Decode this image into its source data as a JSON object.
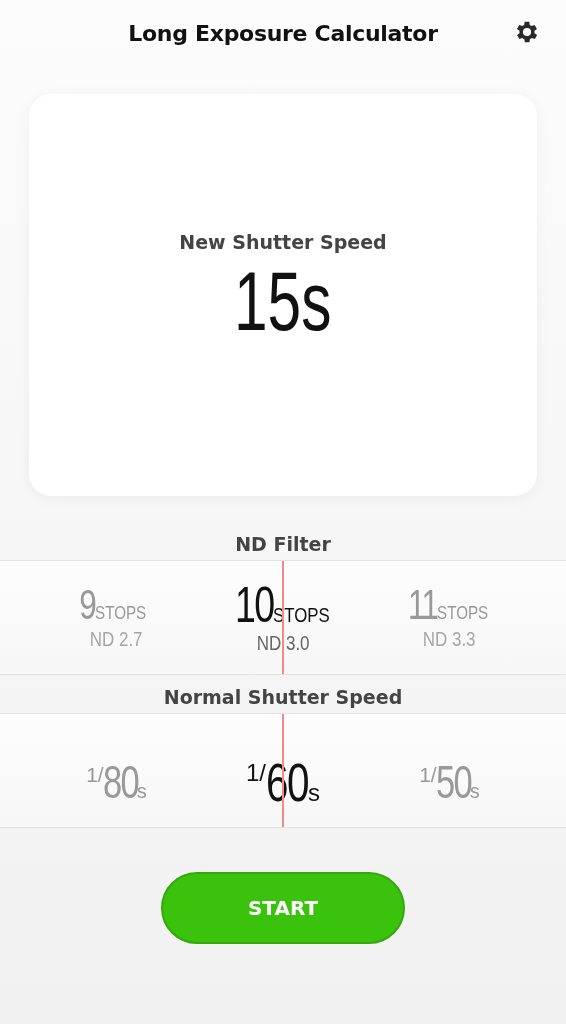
{
  "header": {
    "title": "Long Exposure Calculator"
  },
  "result": {
    "label": "New Shutter Speed",
    "value": "15s"
  },
  "nd_filter": {
    "label": "ND Filter",
    "items": [
      {
        "value": "9",
        "unit": "STOPS",
        "nd": "ND 2.7",
        "selected": false
      },
      {
        "value": "10",
        "unit": "STOPS",
        "nd": "ND 3.0",
        "selected": true
      },
      {
        "value": "11",
        "unit": "STOPS",
        "nd": "ND 3.3",
        "selected": false
      }
    ]
  },
  "shutter": {
    "label": "Normal Shutter Speed",
    "items": [
      {
        "prefix": "1/",
        "value": "80",
        "unit": "s",
        "selected": false
      },
      {
        "prefix": "1/",
        "value": "60",
        "unit": "s",
        "selected": true
      },
      {
        "prefix": "1/",
        "value": "50",
        "unit": "s",
        "selected": false
      }
    ]
  },
  "start_button": {
    "label": "START"
  }
}
